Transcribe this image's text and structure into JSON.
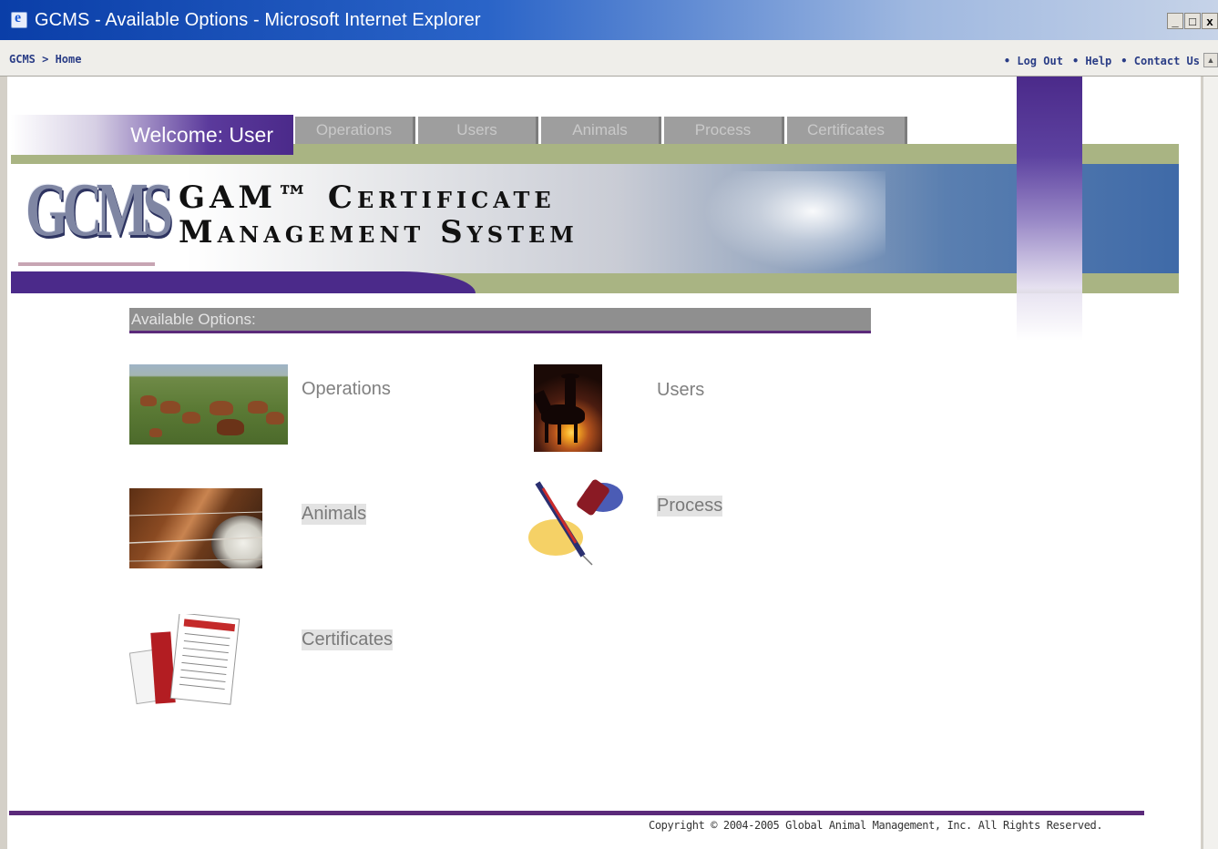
{
  "window": {
    "title": "GCMS - Available Options - Microsoft Internet Explorer",
    "controls": [
      "_",
      "□",
      "x"
    ]
  },
  "toolbar": {
    "breadcrumb": "GCMS > Home",
    "links": [
      "• Log Out",
      "• Help",
      "• Contact Us"
    ]
  },
  "header": {
    "welcome": "Welcome: User",
    "tabs": [
      "Operations",
      "Users",
      "Animals",
      "Process",
      "Certificates"
    ],
    "logo": "GCMS",
    "title_line1": "GAM™ Certificate",
    "title_line2": "Management System"
  },
  "options": {
    "heading": "Available Options:",
    "items": {
      "operations": "Operations",
      "users": "Users",
      "animals": "Animals",
      "process": "Process",
      "certificates": "Certificates"
    }
  },
  "footer": {
    "copyright": "Copyright © 2004-2005 Global Animal Management, Inc. All Rights Reserved."
  },
  "colors": {
    "purple": "#4b2a8a",
    "olive": "#a9b483",
    "nav_gray": "#9e9e9e",
    "banner_blue": "#3f6aa8"
  }
}
